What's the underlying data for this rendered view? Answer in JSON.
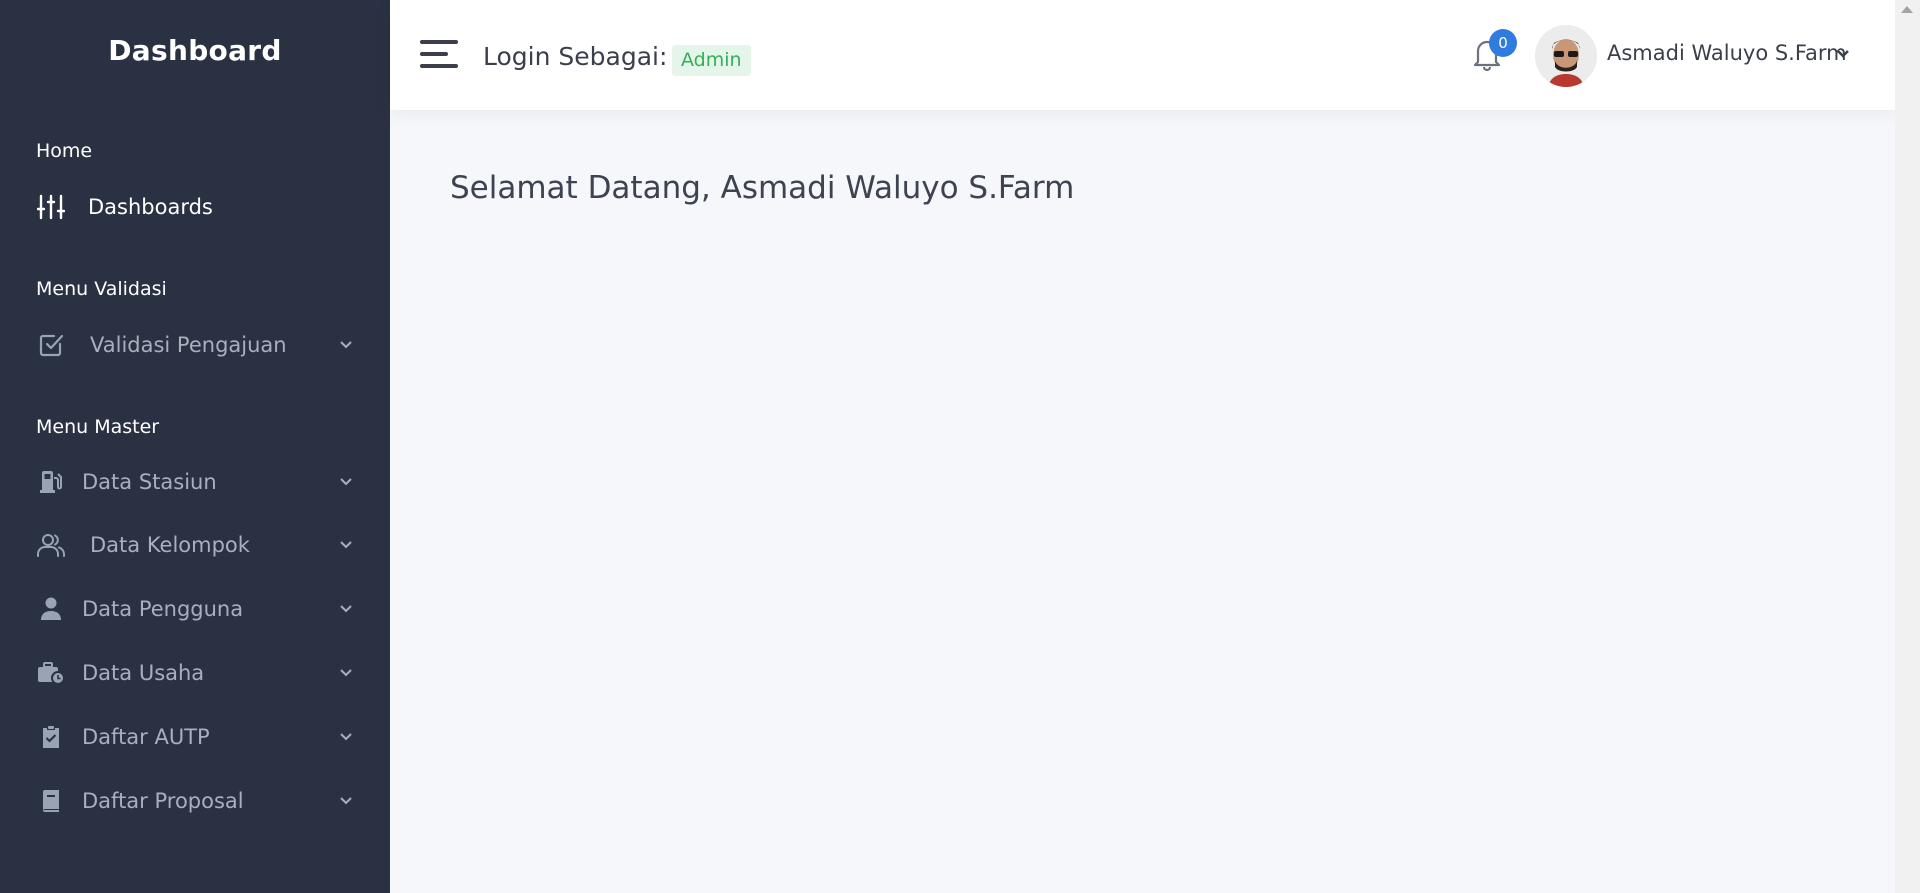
{
  "sidebar": {
    "brand": "Dashboard",
    "sections": {
      "home": "Home",
      "validasi": "Menu Validasi",
      "master": "Menu Master"
    },
    "items": {
      "dashboards": {
        "label": "Dashboards",
        "icon": "sliders-icon"
      },
      "validasi_pengajuan": {
        "label": "Validasi Pengajuan",
        "icon": "checkbox-icon"
      },
      "data_stasiun": {
        "label": "Data Stasiun",
        "icon": "gas-station-icon"
      },
      "data_kelompok": {
        "label": "Data Kelompok",
        "icon": "users-icon"
      },
      "data_pengguna": {
        "label": "Data Pengguna",
        "icon": "user-icon"
      },
      "data_usaha": {
        "label": "Data Usaha",
        "icon": "briefcase-clock-icon"
      },
      "daftar_autp": {
        "label": "Daftar AUTP",
        "icon": "clipboard-check-icon"
      },
      "daftar_proposal": {
        "label": "Daftar Proposal",
        "icon": "book-icon"
      }
    }
  },
  "header": {
    "login_label": "Login Sebagai:",
    "role": "Admin",
    "notification_count": "0",
    "user_name": "Asmadi Waluyo S.Farm"
  },
  "main": {
    "welcome": "Selamat Datang, Asmadi Waluyo S.Farm"
  },
  "colors": {
    "sidebar_bg": "#2a3142",
    "badge_bg": "#2f7be0",
    "role_badge_text": "#33b05a"
  }
}
